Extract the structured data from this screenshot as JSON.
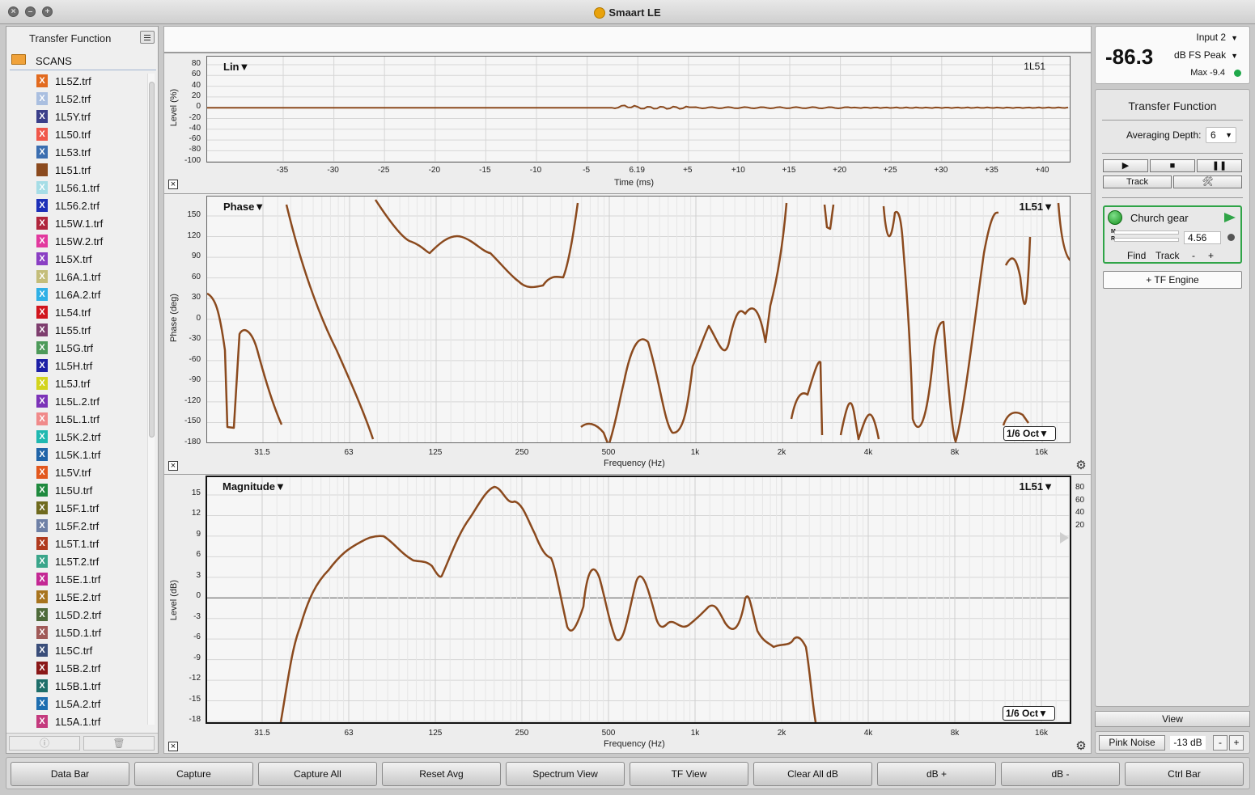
{
  "window": {
    "title": "Smaart LE"
  },
  "sidebar": {
    "title": "Transfer Function",
    "folder": "SCANS",
    "files": [
      {
        "name": "1L5Z.trf",
        "color": "#e26a1e"
      },
      {
        "name": "1L52.trf",
        "color": "#aabfe0"
      },
      {
        "name": "1L5Y.trf",
        "color": "#3b3f8a"
      },
      {
        "name": "1L50.trf",
        "color": "#f0574a"
      },
      {
        "name": "1L53.trf",
        "color": "#3b6eb0"
      },
      {
        "name": "1L51.trf",
        "color": "#8b4a1e"
      },
      {
        "name": "1L56.1.trf",
        "color": "#a6dde6"
      },
      {
        "name": "1L56.2.trf",
        "color": "#1c2fb8"
      },
      {
        "name": "1L5W.1.trf",
        "color": "#b0253c"
      },
      {
        "name": "1L5W.2.trf",
        "color": "#e2399e"
      },
      {
        "name": "1L5X.trf",
        "color": "#8a3fc4"
      },
      {
        "name": "1L6A.1.trf",
        "color": "#c4bd7a"
      },
      {
        "name": "1L6A.2.trf",
        "color": "#2fb0e6"
      },
      {
        "name": "1L54.trf",
        "color": "#d1151d"
      },
      {
        "name": "1L55.trf",
        "color": "#7e3e6e"
      },
      {
        "name": "1L5G.trf",
        "color": "#4d9a5a"
      },
      {
        "name": "1L5H.trf",
        "color": "#1c1fa6"
      },
      {
        "name": "1L5J.trf",
        "color": "#d3d41c"
      },
      {
        "name": "1L5L.2.trf",
        "color": "#7c33b8"
      },
      {
        "name": "1L5L.1.trf",
        "color": "#f08a8a"
      },
      {
        "name": "1L5K.2.trf",
        "color": "#1fb8b0"
      },
      {
        "name": "1L5K.1.trf",
        "color": "#2064a8"
      },
      {
        "name": "1L5V.trf",
        "color": "#e2581e"
      },
      {
        "name": "1L5U.trf",
        "color": "#1f8a3e"
      },
      {
        "name": "1L5F.1.trf",
        "color": "#6f6a1e"
      },
      {
        "name": "1L5F.2.trf",
        "color": "#6e80a6"
      },
      {
        "name": "1L5T.1.trf",
        "color": "#b03a1e"
      },
      {
        "name": "1L5T.2.trf",
        "color": "#3aa58a"
      },
      {
        "name": "1L5E.1.trf",
        "color": "#c42894"
      },
      {
        "name": "1L5E.2.trf",
        "color": "#a8741e"
      },
      {
        "name": "1L5D.2.trf",
        "color": "#4e6a3a"
      },
      {
        "name": "1L5D.1.trf",
        "color": "#a05a58"
      },
      {
        "name": "1L5C.trf",
        "color": "#3a4e7a"
      },
      {
        "name": "1L5B.2.trf",
        "color": "#8a1818"
      },
      {
        "name": "1L5B.1.trf",
        "color": "#1e6e6a"
      },
      {
        "name": "1L5A.2.trf",
        "color": "#1e6eb0"
      },
      {
        "name": "1L5A.1.trf",
        "color": "#c43a7e"
      }
    ]
  },
  "graphs": {
    "impulse": {
      "label": "Lin▼",
      "trace": "1L51",
      "ylabel": "Level (%)",
      "xlabel": "Time (ms)",
      "yticks": [
        "80",
        "60",
        "40",
        "20",
        "0",
        "-20",
        "-40",
        "-60",
        "-80",
        "-100"
      ],
      "xticks": [
        "-35",
        "-30",
        "-25",
        "-20",
        "-15",
        "-10",
        "-5",
        "6.19",
        "+5",
        "+10",
        "+15",
        "+20",
        "+25",
        "+30",
        "+35",
        "+40"
      ]
    },
    "phase": {
      "label": "Phase▼",
      "trace": "1L51▼",
      "ylabel": "Phase (deg)",
      "xlabel": "Frequency (Hz)",
      "yticks": [
        "150",
        "120",
        "90",
        "60",
        "30",
        "0",
        "-30",
        "-60",
        "-90",
        "-120",
        "-150",
        "-180"
      ],
      "xticks": [
        "31.5",
        "63",
        "125",
        "250",
        "500",
        "1k",
        "2k",
        "4k",
        "8k",
        "16k"
      ],
      "smoothing": "1/6 Oct▼"
    },
    "magnitude": {
      "label": "Magnitude▼",
      "trace": "1L51▼",
      "ylabel": "Level (dB)",
      "xlabel": "Frequency (Hz)",
      "yticks": [
        "15",
        "12",
        "9",
        "6",
        "3",
        "0",
        "-3",
        "-6",
        "-9",
        "-12",
        "-15",
        "-18"
      ],
      "xticks": [
        "31.5",
        "63",
        "125",
        "250",
        "500",
        "1k",
        "2k",
        "4k",
        "8k",
        "16k"
      ],
      "right_scale": [
        "80",
        "60",
        "40",
        "20"
      ],
      "smoothing": "1/6 Oct▼"
    },
    "trace_color": "#8b4a1e"
  },
  "meter": {
    "value": "-86.3",
    "input": "Input 2",
    "mode": "dB FS Peak",
    "max": "Max -9.4"
  },
  "control": {
    "title": "Transfer Function",
    "averaging_label": "Averaging Depth:",
    "averaging_value": "6",
    "track_label": "Track",
    "engine": {
      "name": "Church gear",
      "m_label": "M",
      "r_label": "R",
      "delay": "4.56",
      "find": "Find",
      "track": "Track",
      "minus": "-",
      "plus": "+"
    },
    "add_engine": "+ TF Engine",
    "view": "View",
    "pink_noise": "Pink Noise",
    "noise_level": "-13 dB",
    "noise_minus": "-",
    "noise_plus": "+"
  },
  "bottom_buttons": [
    "Data Bar",
    "Capture",
    "Capture All",
    "Reset Avg",
    "Spectrum View",
    "TF View",
    "Clear All dB",
    "dB +",
    "dB -",
    "Ctrl Bar"
  ]
}
